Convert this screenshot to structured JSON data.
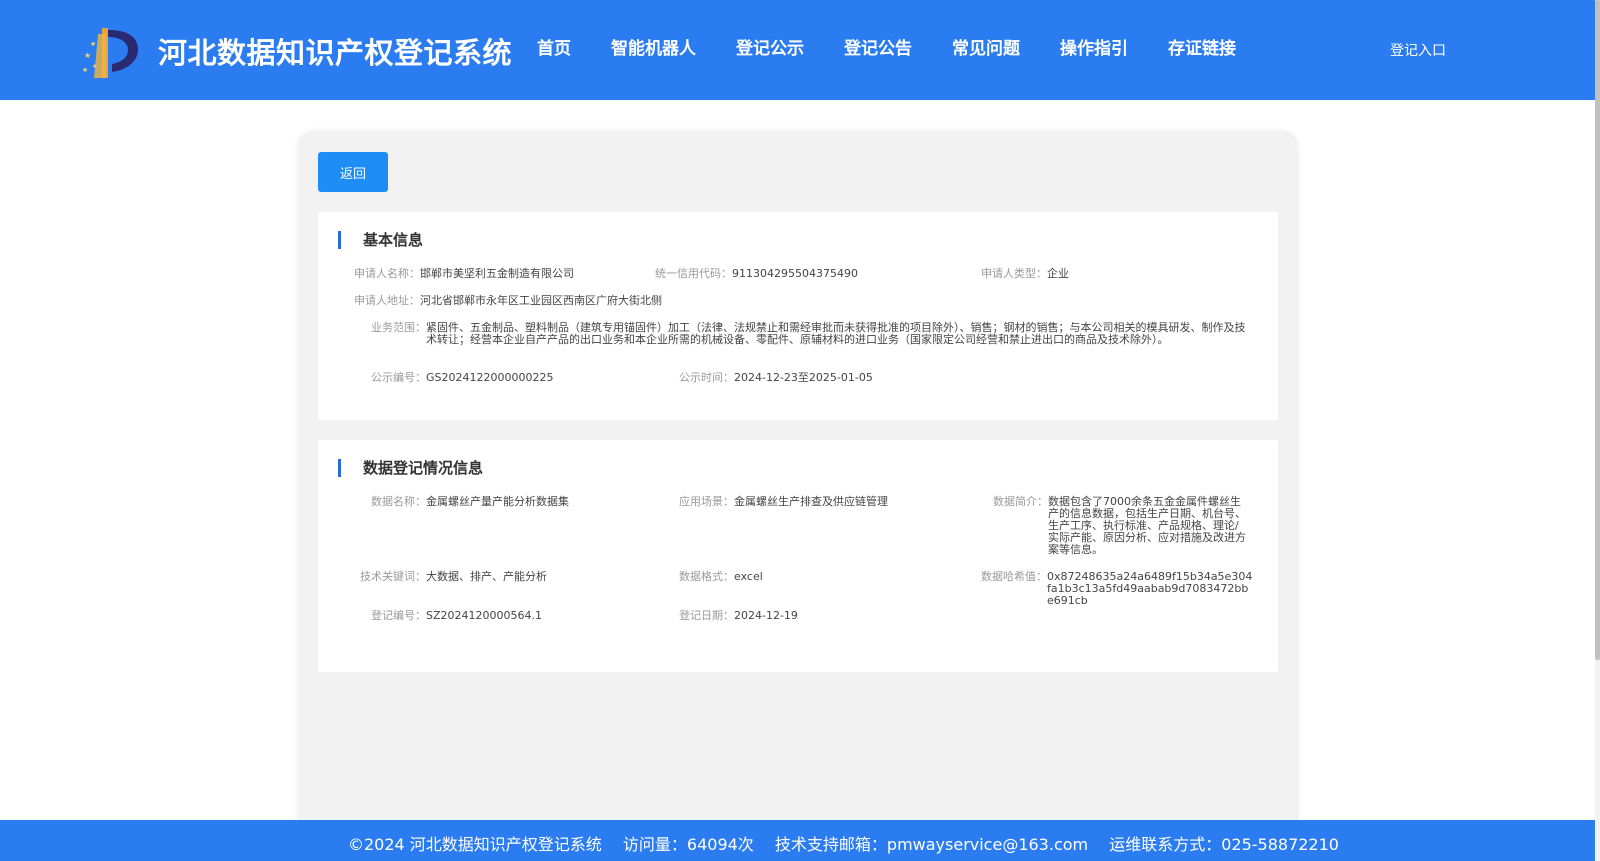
{
  "header": {
    "site_title": "河北数据知识产权登记系统",
    "nav": [
      "首页",
      "智能机器人",
      "登记公示",
      "登记公告",
      "常见问题",
      "操作指引",
      "存证链接"
    ],
    "login": "登记入口"
  },
  "back_label": "返回",
  "basic": {
    "title": "基本信息",
    "applicant_name_label": "申请人名称：",
    "applicant_name": "邯郸市美坚利五金制造有限公司",
    "credit_code_label": "统一信用代码：",
    "credit_code": "911304295504375490",
    "applicant_type_label": "申请人类型：",
    "applicant_type": "企业",
    "address_label": "申请人地址：",
    "address": "河北省邯郸市永年区工业园区西南区广府大街北侧",
    "business_scope_label": "业务范围：",
    "business_scope": "紧固件、五金制品、塑料制品（建筑专用锚固件）加工（法律、法规禁止和需经审批而未获得批准的项目除外）、销售；钢材的销售；与本公司相关的模具研发、制作及技术转让；经营本企业自产产品的出口业务和本企业所需的机械设备、零配件、原辅材料的进口业务（国家限定公司经营和禁止进出口的商品及技术除外）。",
    "publicity_no_label": "公示编号：",
    "publicity_no": "GS2024122000000225",
    "publicity_time_label": "公示时间：",
    "publicity_time": "2024-12-23至2025-01-05"
  },
  "data_info": {
    "title": "数据登记情况信息",
    "data_name_label": "数据名称：",
    "data_name": "金属螺丝产量产能分析数据集",
    "scenario_label": "应用场景：",
    "scenario": "金属螺丝生产排查及供应链管理",
    "intro_label": "数据简介：",
    "intro": "数据包含了7000余条五金金属件螺丝生产的信息数据，包括生产日期、机台号、生产工序、执行标准、产品规格、理论/实际产能、原因分析、应对措施及改进方案等信息。",
    "keywords_label": "技术关键词：",
    "keywords": "大数据、排产、产能分析",
    "format_label": "数据格式：",
    "format": "excel",
    "hash_label": "数据哈希值：",
    "hash": "0x87248635a24a6489f15b34a5e304fa1b3c13a5fd49aabab9d7083472bbe691cb",
    "reg_no_label": "登记编号：",
    "reg_no": "SZ2024120000564.1",
    "reg_date_label": "登记日期：",
    "reg_date": "2024-12-19"
  },
  "footer": {
    "copyright": "©2024 河北数据知识产权登记系统",
    "visits": "访问量：64094次",
    "email": "技术支持邮箱：pmwayservice@163.com",
    "contact": "运维联系方式：025-58872210"
  }
}
